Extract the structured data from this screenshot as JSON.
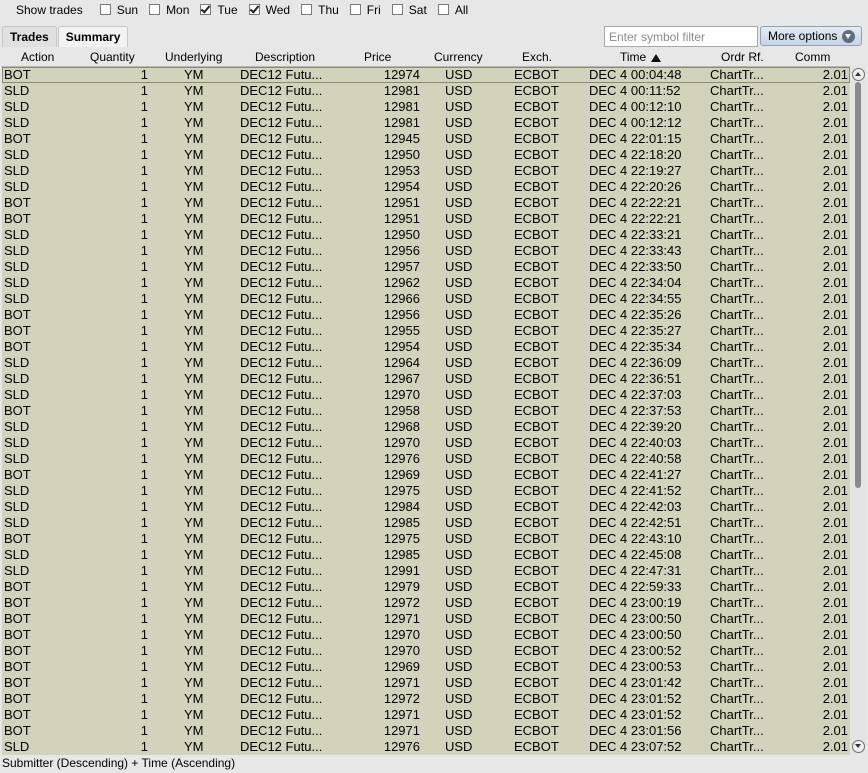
{
  "filter_bar": {
    "label": "Show trades",
    "days": [
      {
        "label": "Sun",
        "checked": false
      },
      {
        "label": "Mon",
        "checked": false
      },
      {
        "label": "Tue",
        "checked": true
      },
      {
        "label": "Wed",
        "checked": true
      },
      {
        "label": "Thu",
        "checked": false
      },
      {
        "label": "Fri",
        "checked": false
      },
      {
        "label": "Sat",
        "checked": false
      },
      {
        "label": "All",
        "checked": false
      }
    ]
  },
  "tabs": [
    {
      "label": "Trades",
      "active": false
    },
    {
      "label": "Summary",
      "active": true
    }
  ],
  "symbol_filter": {
    "placeholder": "Enter symbol filter",
    "value": ""
  },
  "more_options_label": "More options",
  "columns": [
    "Action",
    "Quantity",
    "Underlying",
    "Description",
    "Price",
    "Currency",
    "Exch.",
    "Time",
    "Ordr Rf.",
    "Comm"
  ],
  "sort_icon": "sort-ascending-icon",
  "rows": [
    [
      "BOT",
      "1",
      "YM",
      "DEC12 Futu...",
      "12974",
      "USD",
      "ECBOT",
      "DEC 4 00:04:48",
      "ChartTr...",
      "2.01"
    ],
    [
      "SLD",
      "1",
      "YM",
      "DEC12 Futu...",
      "12981",
      "USD",
      "ECBOT",
      "DEC 4 00:11:52",
      "ChartTr...",
      "2.01"
    ],
    [
      "SLD",
      "1",
      "YM",
      "DEC12 Futu...",
      "12981",
      "USD",
      "ECBOT",
      "DEC 4 00:12:10",
      "ChartTr...",
      "2.01"
    ],
    [
      "SLD",
      "1",
      "YM",
      "DEC12 Futu...",
      "12981",
      "USD",
      "ECBOT",
      "DEC 4 00:12:12",
      "ChartTr...",
      "2.01"
    ],
    [
      "BOT",
      "1",
      "YM",
      "DEC12 Futu...",
      "12945",
      "USD",
      "ECBOT",
      "DEC 4 22:01:15",
      "ChartTr...",
      "2.01"
    ],
    [
      "SLD",
      "1",
      "YM",
      "DEC12 Futu...",
      "12950",
      "USD",
      "ECBOT",
      "DEC 4 22:18:20",
      "ChartTr...",
      "2.01"
    ],
    [
      "SLD",
      "1",
      "YM",
      "DEC12 Futu...",
      "12953",
      "USD",
      "ECBOT",
      "DEC 4 22:19:27",
      "ChartTr...",
      "2.01"
    ],
    [
      "SLD",
      "1",
      "YM",
      "DEC12 Futu...",
      "12954",
      "USD",
      "ECBOT",
      "DEC 4 22:20:26",
      "ChartTr...",
      "2.01"
    ],
    [
      "BOT",
      "1",
      "YM",
      "DEC12 Futu...",
      "12951",
      "USD",
      "ECBOT",
      "DEC 4 22:22:21",
      "ChartTr...",
      "2.01"
    ],
    [
      "BOT",
      "1",
      "YM",
      "DEC12 Futu...",
      "12951",
      "USD",
      "ECBOT",
      "DEC 4 22:22:21",
      "ChartTr...",
      "2.01"
    ],
    [
      "SLD",
      "1",
      "YM",
      "DEC12 Futu...",
      "12950",
      "USD",
      "ECBOT",
      "DEC 4 22:33:21",
      "ChartTr...",
      "2.01"
    ],
    [
      "SLD",
      "1",
      "YM",
      "DEC12 Futu...",
      "12956",
      "USD",
      "ECBOT",
      "DEC 4 22:33:43",
      "ChartTr...",
      "2.01"
    ],
    [
      "SLD",
      "1",
      "YM",
      "DEC12 Futu...",
      "12957",
      "USD",
      "ECBOT",
      "DEC 4 22:33:50",
      "ChartTr...",
      "2.01"
    ],
    [
      "SLD",
      "1",
      "YM",
      "DEC12 Futu...",
      "12962",
      "USD",
      "ECBOT",
      "DEC 4 22:34:04",
      "ChartTr...",
      "2.01"
    ],
    [
      "SLD",
      "1",
      "YM",
      "DEC12 Futu...",
      "12966",
      "USD",
      "ECBOT",
      "DEC 4 22:34:55",
      "ChartTr...",
      "2.01"
    ],
    [
      "BOT",
      "1",
      "YM",
      "DEC12 Futu...",
      "12956",
      "USD",
      "ECBOT",
      "DEC 4 22:35:26",
      "ChartTr...",
      "2.01"
    ],
    [
      "BOT",
      "1",
      "YM",
      "DEC12 Futu...",
      "12955",
      "USD",
      "ECBOT",
      "DEC 4 22:35:27",
      "ChartTr...",
      "2.01"
    ],
    [
      "BOT",
      "1",
      "YM",
      "DEC12 Futu...",
      "12954",
      "USD",
      "ECBOT",
      "DEC 4 22:35:34",
      "ChartTr...",
      "2.01"
    ],
    [
      "SLD",
      "1",
      "YM",
      "DEC12 Futu...",
      "12964",
      "USD",
      "ECBOT",
      "DEC 4 22:36:09",
      "ChartTr...",
      "2.01"
    ],
    [
      "SLD",
      "1",
      "YM",
      "DEC12 Futu...",
      "12967",
      "USD",
      "ECBOT",
      "DEC 4 22:36:51",
      "ChartTr...",
      "2.01"
    ],
    [
      "SLD",
      "1",
      "YM",
      "DEC12 Futu...",
      "12970",
      "USD",
      "ECBOT",
      "DEC 4 22:37:03",
      "ChartTr...",
      "2.01"
    ],
    [
      "BOT",
      "1",
      "YM",
      "DEC12 Futu...",
      "12958",
      "USD",
      "ECBOT",
      "DEC 4 22:37:53",
      "ChartTr...",
      "2.01"
    ],
    [
      "SLD",
      "1",
      "YM",
      "DEC12 Futu...",
      "12968",
      "USD",
      "ECBOT",
      "DEC 4 22:39:20",
      "ChartTr...",
      "2.01"
    ],
    [
      "SLD",
      "1",
      "YM",
      "DEC12 Futu...",
      "12970",
      "USD",
      "ECBOT",
      "DEC 4 22:40:03",
      "ChartTr...",
      "2.01"
    ],
    [
      "SLD",
      "1",
      "YM",
      "DEC12 Futu...",
      "12976",
      "USD",
      "ECBOT",
      "DEC 4 22:40:58",
      "ChartTr...",
      "2.01"
    ],
    [
      "BOT",
      "1",
      "YM",
      "DEC12 Futu...",
      "12969",
      "USD",
      "ECBOT",
      "DEC 4 22:41:27",
      "ChartTr...",
      "2.01"
    ],
    [
      "SLD",
      "1",
      "YM",
      "DEC12 Futu...",
      "12975",
      "USD",
      "ECBOT",
      "DEC 4 22:41:52",
      "ChartTr...",
      "2.01"
    ],
    [
      "SLD",
      "1",
      "YM",
      "DEC12 Futu...",
      "12984",
      "USD",
      "ECBOT",
      "DEC 4 22:42:03",
      "ChartTr...",
      "2.01"
    ],
    [
      "SLD",
      "1",
      "YM",
      "DEC12 Futu...",
      "12985",
      "USD",
      "ECBOT",
      "DEC 4 22:42:51",
      "ChartTr...",
      "2.01"
    ],
    [
      "BOT",
      "1",
      "YM",
      "DEC12 Futu...",
      "12975",
      "USD",
      "ECBOT",
      "DEC 4 22:43:10",
      "ChartTr...",
      "2.01"
    ],
    [
      "SLD",
      "1",
      "YM",
      "DEC12 Futu...",
      "12985",
      "USD",
      "ECBOT",
      "DEC 4 22:45:08",
      "ChartTr...",
      "2.01"
    ],
    [
      "SLD",
      "1",
      "YM",
      "DEC12 Futu...",
      "12991",
      "USD",
      "ECBOT",
      "DEC 4 22:47:31",
      "ChartTr...",
      "2.01"
    ],
    [
      "BOT",
      "1",
      "YM",
      "DEC12 Futu...",
      "12979",
      "USD",
      "ECBOT",
      "DEC 4 22:59:33",
      "ChartTr...",
      "2.01"
    ],
    [
      "BOT",
      "1",
      "YM",
      "DEC12 Futu...",
      "12972",
      "USD",
      "ECBOT",
      "DEC 4 23:00:19",
      "ChartTr...",
      "2.01"
    ],
    [
      "BOT",
      "1",
      "YM",
      "DEC12 Futu...",
      "12971",
      "USD",
      "ECBOT",
      "DEC 4 23:00:50",
      "ChartTr...",
      "2.01"
    ],
    [
      "BOT",
      "1",
      "YM",
      "DEC12 Futu...",
      "12970",
      "USD",
      "ECBOT",
      "DEC 4 23:00:50",
      "ChartTr...",
      "2.01"
    ],
    [
      "BOT",
      "1",
      "YM",
      "DEC12 Futu...",
      "12970",
      "USD",
      "ECBOT",
      "DEC 4 23:00:52",
      "ChartTr...",
      "2.01"
    ],
    [
      "BOT",
      "1",
      "YM",
      "DEC12 Futu...",
      "12969",
      "USD",
      "ECBOT",
      "DEC 4 23:00:53",
      "ChartTr...",
      "2.01"
    ],
    [
      "BOT",
      "1",
      "YM",
      "DEC12 Futu...",
      "12971",
      "USD",
      "ECBOT",
      "DEC 4 23:01:42",
      "ChartTr...",
      "2.01"
    ],
    [
      "BOT",
      "1",
      "YM",
      "DEC12 Futu...",
      "12972",
      "USD",
      "ECBOT",
      "DEC 4 23:01:52",
      "ChartTr...",
      "2.01"
    ],
    [
      "BOT",
      "1",
      "YM",
      "DEC12 Futu...",
      "12971",
      "USD",
      "ECBOT",
      "DEC 4 23:01:52",
      "ChartTr...",
      "2.01"
    ],
    [
      "BOT",
      "1",
      "YM",
      "DEC12 Futu...",
      "12971",
      "USD",
      "ECBOT",
      "DEC 4 23:01:56",
      "ChartTr...",
      "2.01"
    ],
    [
      "SLD",
      "1",
      "YM",
      "DEC12 Futu...",
      "12976",
      "USD",
      "ECBOT",
      "DEC 4 23:07:52",
      "ChartTr...",
      "2.01"
    ]
  ],
  "status_text": "Submitter (Descending)  +  Time (Ascending)",
  "colors": {
    "grid_bg": "#d3d3bc",
    "window_bg": "#e7e7e7"
  }
}
